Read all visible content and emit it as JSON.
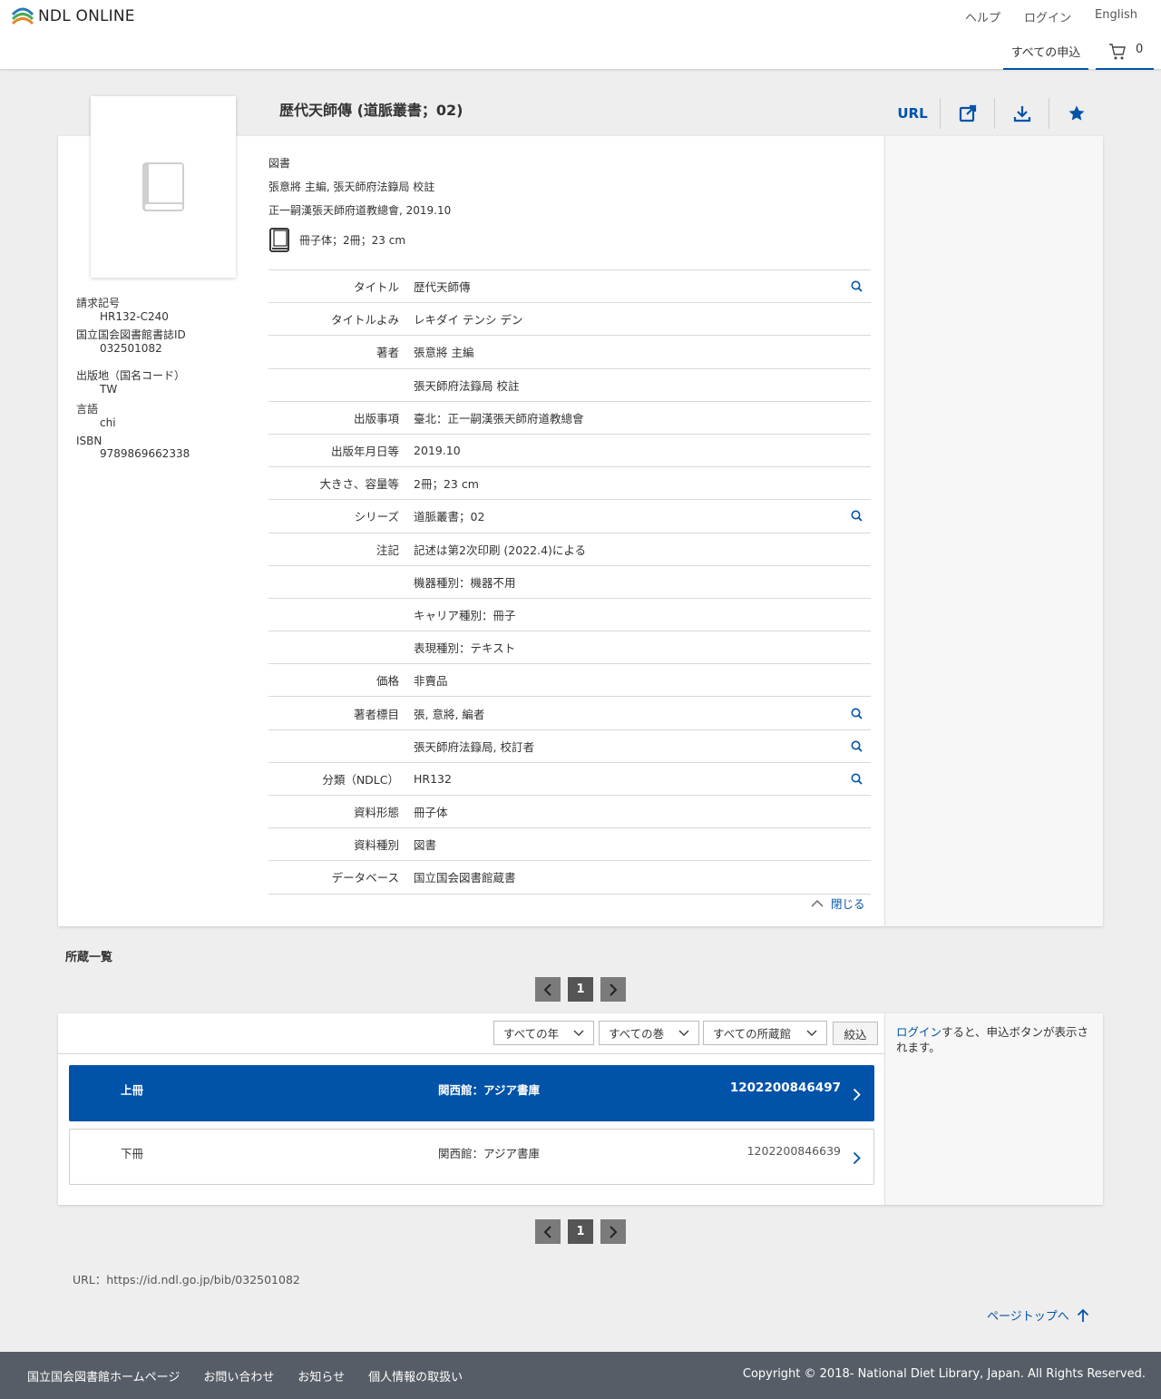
{
  "header": {
    "logo_text": "NDL ONLINE",
    "links": [
      "ヘルプ",
      "ログイン",
      "English"
    ],
    "apply_all": "すべての申込",
    "cart_count": "0"
  },
  "record": {
    "title": "歴代天師傳 (道脈叢書；02)",
    "actions": {
      "url_label": "URL"
    },
    "summary": {
      "type": "図書",
      "responsibility": "張意將 主編, 張天師府法籙局 校註",
      "publication": "正一嗣漢張天師府道教總會, 2019.10",
      "format": "冊子体；2冊；23 cm"
    },
    "side": {
      "call_no_label": "請求記号",
      "call_no": "HR132-C240",
      "ndl_id_label": "国立国会図書館書誌ID",
      "ndl_id": "032501082",
      "country_label": "出版地（国名コード）",
      "country": "TW",
      "lang_label": "言語",
      "lang": "chi",
      "isbn_label": "ISBN",
      "isbn": "9789869662338"
    },
    "details": [
      {
        "label": "タイトル",
        "value": "歴代天師傳",
        "search": true
      },
      {
        "label": "タイトルよみ",
        "value": "レキダイ テンシ デン",
        "search": false
      },
      {
        "label": "著者",
        "value": "張意將 主編",
        "search": false
      },
      {
        "label": "",
        "value": "張天師府法籙局 校註",
        "search": false
      },
      {
        "label": "出版事項",
        "value": "臺北：正一嗣漢張天師府道教總會",
        "search": false
      },
      {
        "label": "出版年月日等",
        "value": "2019.10",
        "search": false
      },
      {
        "label": "大きさ、容量等",
        "value": "2冊；23 cm",
        "search": false
      },
      {
        "label": "シリーズ",
        "value": "道脈叢書；02",
        "search": true
      },
      {
        "label": "注記",
        "value": "記述は第2次印刷 (2022.4)による",
        "search": false
      },
      {
        "label": "",
        "value": "機器種別：機器不用",
        "search": false
      },
      {
        "label": "",
        "value": "キャリア種別：冊子",
        "search": false
      },
      {
        "label": "",
        "value": "表現種別：テキスト",
        "search": false
      },
      {
        "label": "価格",
        "value": "非賣品",
        "search": false
      },
      {
        "label": "著者標目",
        "value": "張, 意將, 編者",
        "search": true
      },
      {
        "label": "",
        "value": "張天師府法籙局, 校訂者",
        "search": true
      },
      {
        "label": "分類（NDLC）",
        "value": "HR132",
        "search": true
      },
      {
        "label": "資料形態",
        "value": "冊子体",
        "search": false
      },
      {
        "label": "資料種別",
        "value": "図書",
        "search": false
      },
      {
        "label": "データベース",
        "value": "国立国会図書館蔵書",
        "search": false
      }
    ],
    "close_label": "閉じる"
  },
  "holdings": {
    "title": "所蔵一覧",
    "page": "1",
    "filters": {
      "year": "すべての年",
      "volume": "すべての巻",
      "library": "すべての所蔵館",
      "button": "絞込"
    },
    "login_link": "ログイン",
    "login_note": "すると、申込ボタンが表示されます。",
    "items": [
      {
        "volume": "上冊",
        "location": "関西館：アジア書庫",
        "code": "1202200846497"
      },
      {
        "volume": "下冊",
        "location": "関西館：アジア書庫",
        "code": "1202200846639"
      }
    ]
  },
  "url_line": "URL：https://id.ndl.go.jp/bib/032501082",
  "pagetop": "ページトップへ",
  "footer": {
    "links": [
      "国立国会図書館ホームページ",
      "お問い合わせ",
      "お知らせ",
      "個人情報の取扱い"
    ],
    "copyright": "Copyright © 2018- National Diet Library, Japan. All Rights Reserved."
  },
  "colors": {
    "accent": "#0053a8",
    "footer_bg": "#575d66"
  }
}
